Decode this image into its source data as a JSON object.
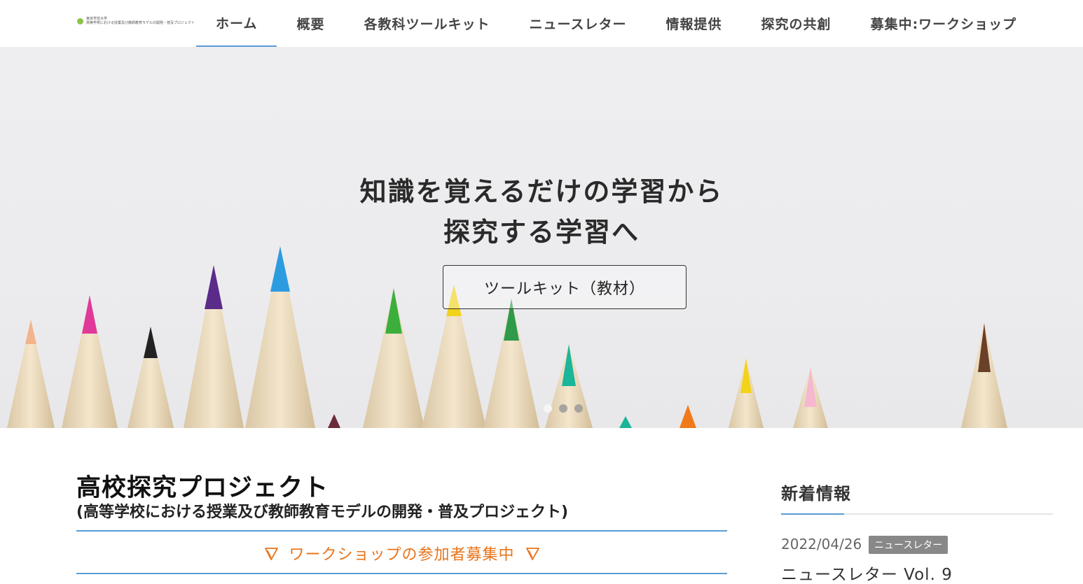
{
  "header": {
    "logo": {
      "line1": "東京学芸大学",
      "line2": "高等学校における授業及び教師教育モデルの開発・普及プロジェクト"
    },
    "nav": [
      {
        "label": "ホーム",
        "active": true
      },
      {
        "label": "概要",
        "active": false
      },
      {
        "label": "各教科ツールキット",
        "active": false
      },
      {
        "label": "ニュースレター",
        "active": false
      },
      {
        "label": "情報提供",
        "active": false
      },
      {
        "label": "探究の共創",
        "active": false
      },
      {
        "label": "募集中:ワークショップ",
        "active": false
      }
    ]
  },
  "hero": {
    "title_line1": "知識を覚えるだけの学習から",
    "title_line2": "探究する学習へ",
    "button_label": "ツールキット（教材）",
    "slides": 3,
    "active_slide": 1
  },
  "main": {
    "title": "高校探究プロジェクト",
    "subtitle": "(高等学校における授業及び教師教育モデルの開発・普及プロジェクト)",
    "banner_text": "ワークショップの参加者募集中",
    "accent_color": "#5b9bd5",
    "banner_color": "#e8741a"
  },
  "sidebar": {
    "title": "新着情報",
    "news": [
      {
        "date": "2022/04/26",
        "tag": "ニュースレター",
        "title": "ニュースレター Vol. 9"
      }
    ]
  }
}
